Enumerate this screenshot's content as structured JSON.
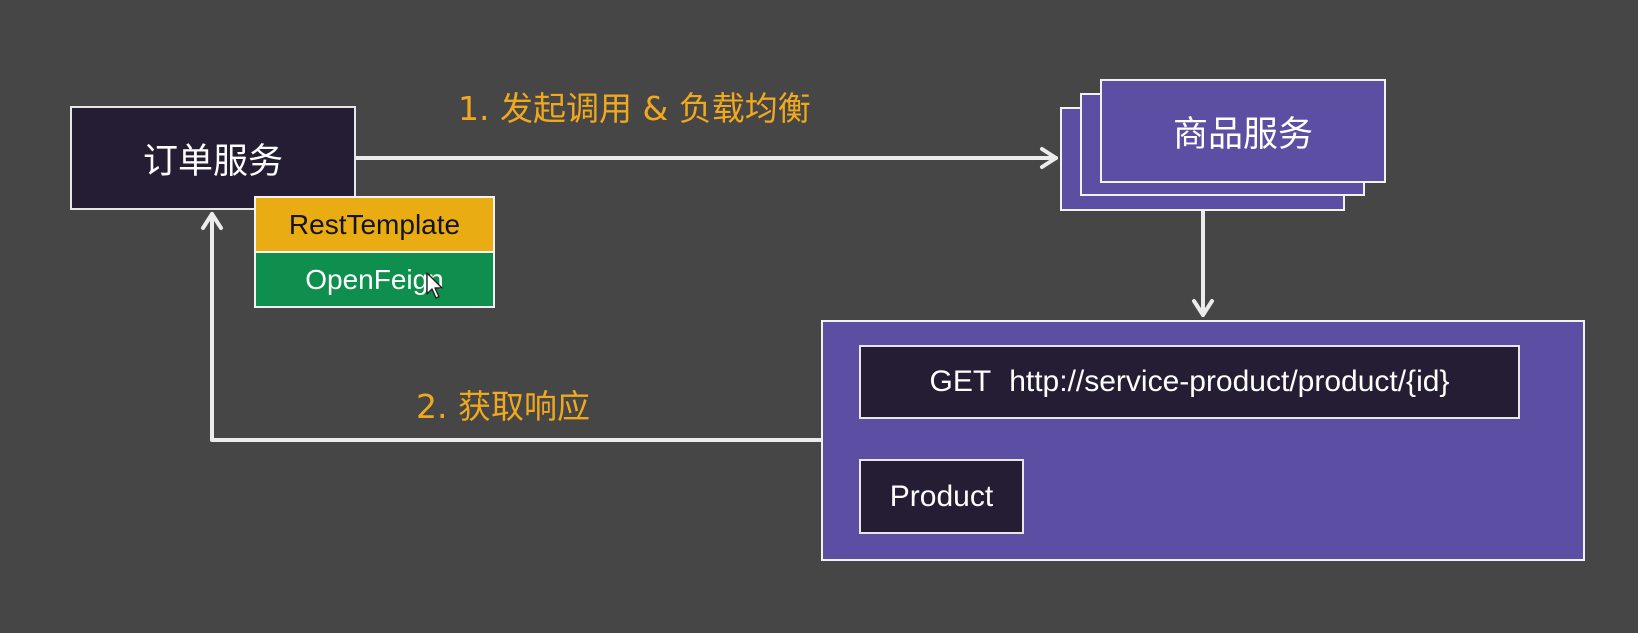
{
  "nodes": {
    "order_service": "订单服务",
    "product_service": "商品服务",
    "rest_template": "RestTemplate",
    "open_feign": "OpenFeign",
    "endpoint_method": "GET",
    "endpoint_url": "http://service-product/product/{id}",
    "product_result": "Product"
  },
  "steps": {
    "step1": "1. 发起调用 & 负载均衡",
    "step2": "2. 获取响应"
  },
  "colors": {
    "background": "#464646",
    "dark_box": "#241d33",
    "purple_box": "#5b4ea3",
    "rest_template": "#e9ac12",
    "open_feign": "#0e8f4e",
    "step_text": "#f0a91e",
    "arrow": "#ececec"
  }
}
